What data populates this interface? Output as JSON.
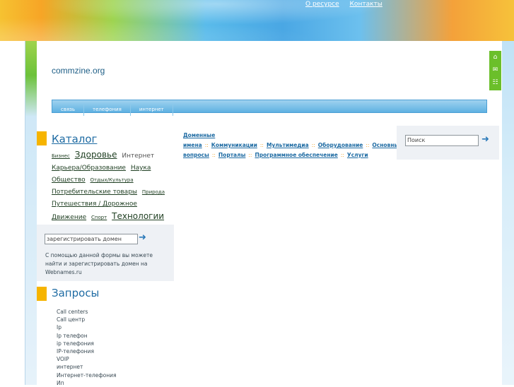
{
  "header": {
    "links": [
      "О ресурсе",
      "Контакты"
    ]
  },
  "site": {
    "title": "commzine.org"
  },
  "menu": [
    "связь",
    "телефония",
    "интернет"
  ],
  "side_icons": [
    "home-icon",
    "mail-icon",
    "sitemap-icon"
  ],
  "catalog": {
    "title": "Каталог",
    "items": [
      {
        "label": "Бизнес",
        "size": "s"
      },
      {
        "label": "Здоровье",
        "size": "l"
      },
      {
        "label": "Интернет",
        "size": "m"
      },
      {
        "label": "Карьера/Образование",
        "size": "m"
      },
      {
        "label": "Наука",
        "size": "m"
      },
      {
        "label": "Общество",
        "size": "m"
      },
      {
        "label": "Отдых/Культура",
        "size": "s"
      },
      {
        "label": "Потребительские товары",
        "size": "m"
      },
      {
        "label": "Природа",
        "size": "s"
      },
      {
        "label": "Путешествия / Дорожное Движение",
        "size": "m"
      },
      {
        "label": "Спорт",
        "size": "s"
      },
      {
        "label": "Технологии",
        "size": "l"
      }
    ]
  },
  "domain": {
    "placeholder": "зарегистрировать домен",
    "text": "С помощью данной формы вы можете найти и зарегистрировать домен на Webnames.ru"
  },
  "queries": {
    "title": "Запросы",
    "items": [
      "Call centers",
      "Call центр",
      "Ip",
      "Ip телефон",
      "ip телефония",
      "IP-телефония",
      "VOIP",
      "интернет",
      "Интернет-телефония",
      "Ип"
    ]
  },
  "topics": [
    "Доменные имена",
    "Коммуникации",
    "Мультимедиа",
    "Оборудование",
    "Основные вопросы",
    "Порталы",
    "Программное обеспечение",
    "Услуги"
  ],
  "search": {
    "placeholder": "Поиск"
  }
}
